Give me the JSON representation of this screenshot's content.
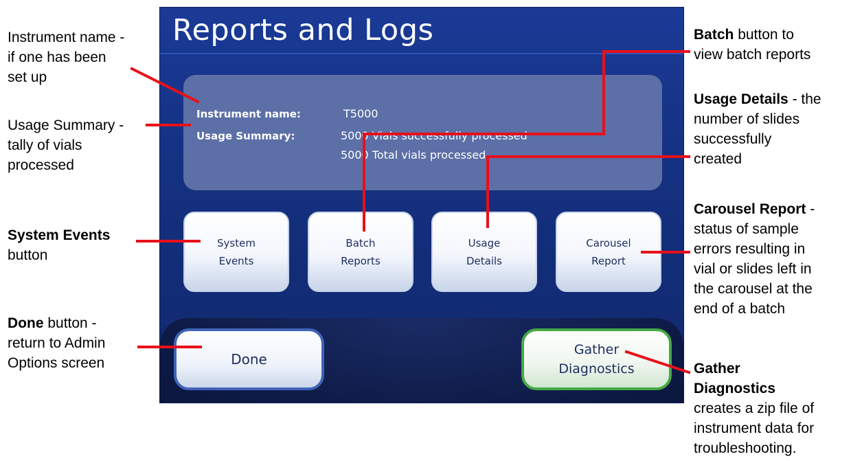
{
  "screen": {
    "title": "Reports and Logs",
    "info": {
      "instrument_label": "Instrument name:",
      "instrument_value": "T5000",
      "usage_label": "Usage Summary:",
      "usage_line1": "5000 Vials successfully processed",
      "usage_line2": "5000 Total vials processed"
    },
    "tiles": [
      {
        "line1": "System",
        "line2": "Events"
      },
      {
        "line1": "Batch",
        "line2": "Reports"
      },
      {
        "line1": "Usage",
        "line2": "Details"
      },
      {
        "line1": "Carousel",
        "line2": "Report"
      }
    ],
    "done_label": "Done",
    "gather_line1": "Gather",
    "gather_line2": "Diagnostics"
  },
  "annotations": {
    "instrument_name": {
      "l1": "Instrument name -",
      "l2": "if one has been",
      "l3": "set up"
    },
    "usage_summary": {
      "l1": "Usage Summary -",
      "l2": "tally of vials",
      "l3": "processed"
    },
    "system_events": {
      "bold": "System Events",
      "rest": "button"
    },
    "done": {
      "bold": "Done",
      "l1_rest": " button -",
      "l2": "return to Admin",
      "l3": "Options screen"
    },
    "batch": {
      "bold": "Batch",
      "l1_rest": " button to",
      "l2": "view batch reports"
    },
    "usage_details": {
      "bold": "Usage Details",
      "l1_rest": " - the",
      "l2": "number of slides",
      "l3": "successfully",
      "l4": "created"
    },
    "carousel": {
      "bold": "Carousel Report",
      "l1_rest": " -",
      "l2": "status of sample",
      "l3": "errors resulting in",
      "l4": "vial or slides left in",
      "l5": "the carousel at the",
      "l6": "end of a batch"
    },
    "gather": {
      "bold1": "Gather",
      "bold2": "Diagnostics",
      "l3": "creates a zip file of",
      "l4": "instrument data for",
      "l5": "troubleshooting."
    }
  },
  "colors": {
    "callout_line": "#e8101a",
    "screen_bg": "#14307f",
    "panel": "#5c6fa6",
    "done_border": "#3f64b8",
    "gather_border": "#45a845"
  }
}
